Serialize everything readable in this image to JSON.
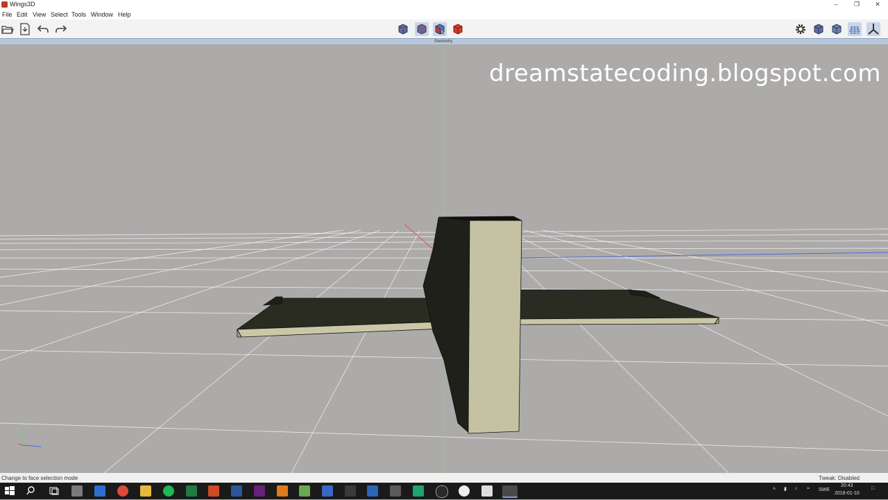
{
  "window": {
    "title": "Wings3D"
  },
  "menu": [
    "File",
    "Edit",
    "View",
    "Select",
    "Tools",
    "Window",
    "Help"
  ],
  "geometry_bar": {
    "label": "Geometry"
  },
  "watermark": "dreamstatecoding.blogspot.com",
  "status": {
    "left": "Change to face selection mode",
    "right": "Tweak: Disabled"
  },
  "taskbar": {
    "lang": "SWE",
    "time": "20:43",
    "date": "2018-01-10"
  },
  "icons": {
    "toolbar_left": [
      "open-folder-icon",
      "save-file-icon",
      "undo-icon",
      "redo-icon"
    ],
    "selection_modes": [
      "vertex-mode-icon",
      "edge-mode-icon",
      "face-mode-icon",
      "object-mode-icon"
    ],
    "toolbar_right": [
      "gear-icon",
      "smooth-preview-icon",
      "wireframe-cube-icon",
      "groundplane-icon",
      "axes-icon"
    ]
  }
}
